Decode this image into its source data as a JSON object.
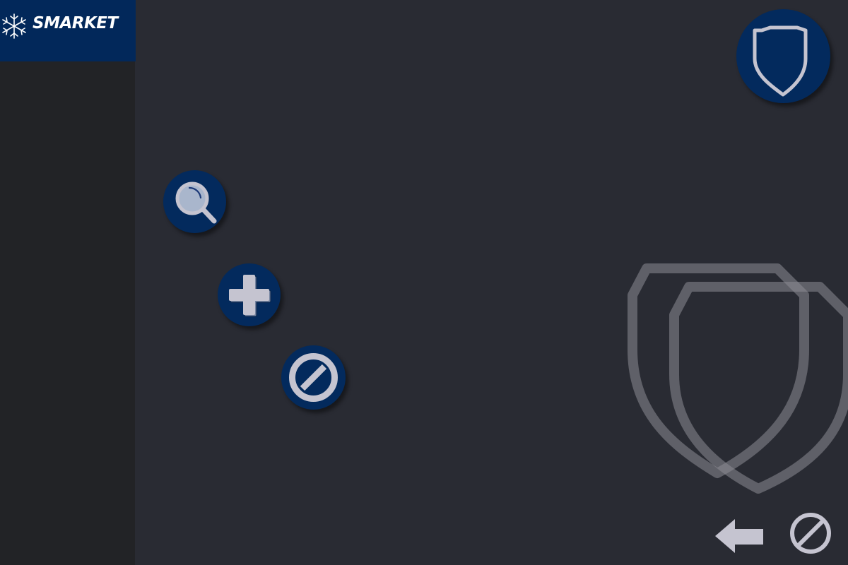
{
  "brand": {
    "name": "SMARKET",
    "logo_icon": "snowflake-icon"
  },
  "colors": {
    "background": "#292b33",
    "sidebar": "#222326",
    "brand_bg": "#02285a",
    "button_bg": "#032a5d",
    "icon_fill": "#c5c4d0"
  },
  "actions": [
    {
      "name": "search",
      "icon": "search-icon"
    },
    {
      "name": "add",
      "icon": "plus-icon"
    },
    {
      "name": "block",
      "icon": "prohibited-icon"
    }
  ],
  "top_right": {
    "icon": "shield-icon"
  },
  "bottom_bar": [
    {
      "name": "back",
      "icon": "arrow-left-icon"
    },
    {
      "name": "block",
      "icon": "prohibited-icon"
    }
  ]
}
